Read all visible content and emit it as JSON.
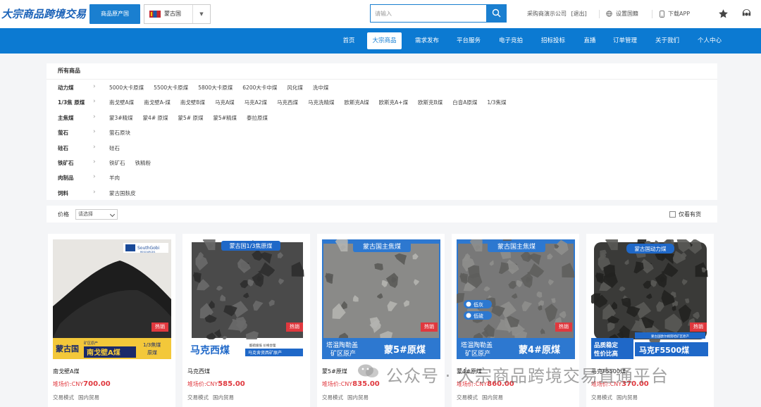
{
  "header": {
    "logo_text": "大宗商品跨境交易",
    "origin_button": "商品原产国",
    "country": "蒙古国",
    "search_placeholder": "请输入",
    "company": "采购商演示公司",
    "logout": "[退出]",
    "set_country": "设置国籍",
    "download_app": "下载APP"
  },
  "nav": {
    "items": [
      "首页",
      "大宗商品",
      "需求发布",
      "平台服务",
      "电子竞拍",
      "招标投标",
      "直播",
      "订单管理",
      "关于我们",
      "个人中心"
    ],
    "active_index": 1
  },
  "categories": {
    "title": "所有商品",
    "rows": [
      {
        "name": "动力煤",
        "items": [
          "5000大卡原煤",
          "5500大卡原煤",
          "5800大卡原煤",
          "6200大卡中煤",
          "风化煤",
          "洗中煤"
        ]
      },
      {
        "name": "1/3焦 原煤",
        "items": [
          "南戈壁A煤",
          "南戈壁A-煤",
          "南戈壁B煤",
          "马克A煤",
          "马克A2煤",
          "马克西煤",
          "马克洗精煤",
          "欧斯克A煤",
          "欧斯克A+煤",
          "欧斯克B煤",
          "白音A原煤",
          "1/3焦煤"
        ]
      },
      {
        "name": "主焦煤",
        "items": [
          "蒙3#精煤",
          "蒙4# 原煤",
          "蒙5# 原煤",
          "蒙5#精煤",
          "泰拉原煤"
        ]
      },
      {
        "name": "萤石",
        "items": [
          "萤石原块"
        ]
      },
      {
        "name": "硅石",
        "items": [
          "硅石"
        ]
      },
      {
        "name": "铁矿石",
        "items": [
          "铁矿石",
          "铁精粉"
        ]
      },
      {
        "name": "肉制品",
        "items": [
          "羊肉"
        ]
      },
      {
        "name": "饲料",
        "items": [
          "蒙古国麸皮"
        ]
      }
    ]
  },
  "filter": {
    "price_label": "价格",
    "price_select": "请选择",
    "in_stock": "仅看有货"
  },
  "products": [
    {
      "name": "南戈壁A煤",
      "price_label": "堆场价:CNY",
      "price": "700.00",
      "mode_label": "交易模式",
      "mode": "国内贸易",
      "hot": "热销",
      "img": {
        "brand": "SouthGobi",
        "brand_sub": "RESOURCES",
        "tag_country": "蒙古国",
        "tag_sub": "矿区原产",
        "tag_name": "南戈壁A煤",
        "tag_type": "1/3焦煤",
        "tag_type2": "原煤"
      }
    },
    {
      "name": "马克西煤",
      "price_label": "堆场价:CNY",
      "price": "585.00",
      "mode_label": "交易模式",
      "mode": "国内贸易",
      "hot": "热销",
      "img": {
        "top": "蒙古国1/3焦原煤",
        "big": "马克西煤",
        "sub1": "酷硫极低 价格合理",
        "sub2": "马克舍资西矿原产"
      }
    },
    {
      "name": "蒙5#原煤",
      "price_label": "堆场价:CNY",
      "price": "835.00",
      "mode_label": "交易模式",
      "mode": "国内贸易",
      "hot": "热销",
      "img": {
        "top": "蒙古国主焦煤",
        "left1": "塔温陶勒盖",
        "left2": "矿区原产",
        "big": "蒙5#原煤"
      }
    },
    {
      "name": "蒙4#原煤",
      "price_label": "堆场价:CNY",
      "price": "860.00",
      "mode_label": "交易模式",
      "mode": "国内贸易",
      "hot": "热销",
      "img": {
        "top": "蒙古国主焦煤",
        "badge1": "低灰",
        "badge2": "低硫",
        "left1": "塔温陶勒盖",
        "left2": "矿区原产",
        "big": "蒙4#原煤"
      }
    },
    {
      "name": "马克F5500煤",
      "price_label": "堆场价:CNY",
      "price": "370.00",
      "mode_label": "交易模式",
      "mode": "国内贸易",
      "hot": "热销",
      "img": {
        "top": "蒙古国动力煤",
        "sub": "蒙古国欧尔姆努哈矿区原产",
        "left1": "品质稳定",
        "left2": "性价比高",
        "big": "马克F5500煤"
      }
    }
  ],
  "watermark": "公众号 · 大宗商品跨境交易直通平台",
  "colors": {
    "primary": "#0c7ad2",
    "price_red": "#e0383e",
    "hot_red": "#e0383e"
  }
}
